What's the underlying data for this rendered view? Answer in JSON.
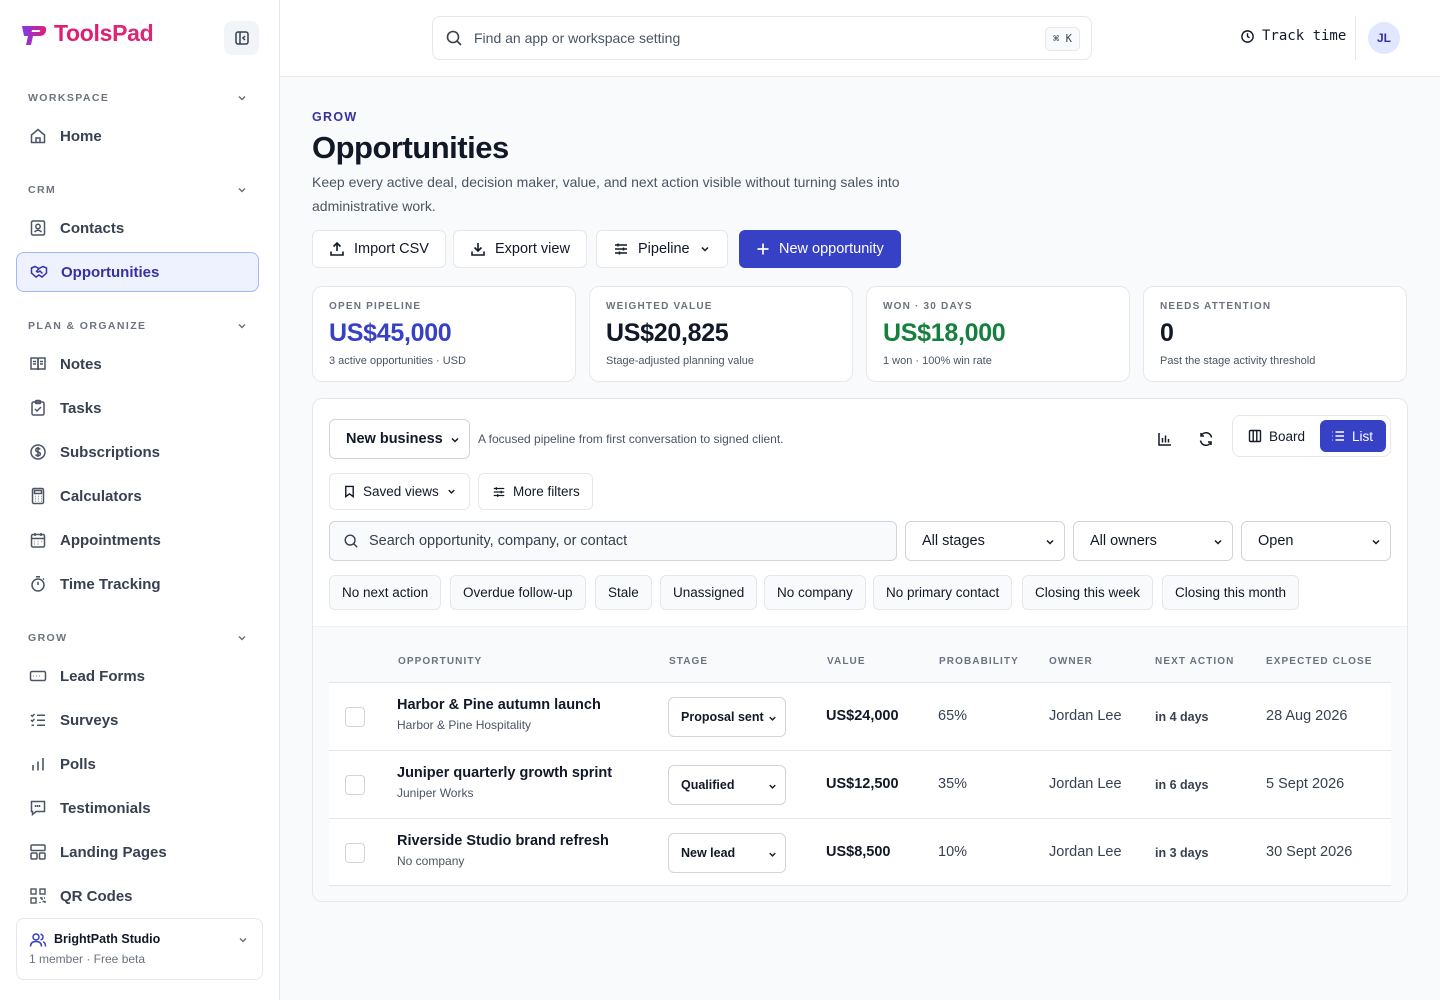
{
  "brand": {
    "name_a": "Tools",
    "name_b": "Pad",
    "accent": "#e11d74"
  },
  "sidebar": {
    "sections": [
      {
        "title": "WORKSPACE"
      },
      {
        "title": "CRM"
      },
      {
        "title": "PLAN & ORGANIZE"
      },
      {
        "title": "GROW"
      }
    ],
    "items": [
      {
        "label": "Home",
        "icon": "home-icon"
      },
      {
        "label": "Contacts",
        "icon": "contact-card-icon"
      },
      {
        "label": "Opportunities",
        "icon": "handshake-icon",
        "active": true
      },
      {
        "label": "Notes",
        "icon": "book-icon"
      },
      {
        "label": "Tasks",
        "icon": "clipboard-check-icon"
      },
      {
        "label": "Subscriptions",
        "icon": "dollar-circle-icon"
      },
      {
        "label": "Calculators",
        "icon": "calculator-icon"
      },
      {
        "label": "Appointments",
        "icon": "calendar-icon"
      },
      {
        "label": "Time Tracking",
        "icon": "stopwatch-icon"
      },
      {
        "label": "Lead Forms",
        "icon": "form-icon"
      },
      {
        "label": "Surveys",
        "icon": "checklist-icon"
      },
      {
        "label": "Polls",
        "icon": "bar-chart-icon"
      },
      {
        "label": "Testimonials",
        "icon": "message-quote-icon"
      },
      {
        "label": "Landing Pages",
        "icon": "layout-icon"
      },
      {
        "label": "QR Codes",
        "icon": "qr-code-icon"
      }
    ],
    "workspace": {
      "name": "BrightPath Studio",
      "meta": "1 member · Free beta"
    }
  },
  "topbar": {
    "search_placeholder": "Find an app or workspace setting",
    "shortcut": "⌘ K",
    "track_label": "Track time",
    "avatar_initials": "JL"
  },
  "page": {
    "eyebrow": "GROW",
    "title": "Opportunities",
    "description": "Keep every active deal, decision maker, value, and next action visible without turning sales into administrative work."
  },
  "actions": {
    "import": "Import CSV",
    "export": "Export view",
    "pipeline": "Pipeline",
    "new": "New opportunity"
  },
  "stats": [
    {
      "label": "OPEN PIPELINE",
      "value": "US$45,000",
      "sub": "3 active opportunities · USD",
      "color": "#3741c6"
    },
    {
      "label": "WEIGHTED VALUE",
      "value": "US$20,825",
      "sub": "Stage-adjusted planning value",
      "color": "#111827"
    },
    {
      "label": "WON · 30 DAYS",
      "value": "US$18,000",
      "sub": "1 won · 100% win rate",
      "color": "#15803d"
    },
    {
      "label": "NEEDS ATTENTION",
      "value": "0",
      "sub": "Past the stage activity threshold",
      "color": "#111827"
    }
  ],
  "panel": {
    "pipeline_select": "New business",
    "pipeline_desc": "A focused pipeline from first conversation to signed client.",
    "view_board": "Board",
    "view_list": "List",
    "saved_views": "Saved views",
    "more_filters": "More filters",
    "search_placeholder": "Search opportunity, company, or contact",
    "filter_stages": "All stages",
    "filter_owners": "All owners",
    "filter_status": "Open",
    "quick_filters": [
      "No next action",
      "Overdue follow-up",
      "Stale",
      "Unassigned",
      "No company",
      "No primary contact",
      "Closing this week",
      "Closing this month"
    ]
  },
  "table": {
    "headers": [
      "OPPORTUNITY",
      "STAGE",
      "VALUE",
      "PROBABILITY",
      "OWNER",
      "NEXT ACTION",
      "EXPECTED CLOSE"
    ],
    "rows": [
      {
        "name": "Harbor & Pine autumn launch",
        "company": "Harbor & Pine Hospitality",
        "stage": "Proposal sent",
        "value": "US$24,000",
        "probability": "65%",
        "owner": "Jordan Lee",
        "next_action": "in 4 days",
        "close": "28 Aug 2026"
      },
      {
        "name": "Juniper quarterly growth sprint",
        "company": "Juniper Works",
        "stage": "Qualified",
        "value": "US$12,500",
        "probability": "35%",
        "owner": "Jordan Lee",
        "next_action": "in 6 days",
        "close": "5 Sept 2026"
      },
      {
        "name": "Riverside Studio brand refresh",
        "company": "No company",
        "stage": "New lead",
        "value": "US$8,500",
        "probability": "10%",
        "owner": "Jordan Lee",
        "next_action": "in 3 days",
        "close": "30 Sept 2026"
      }
    ]
  }
}
